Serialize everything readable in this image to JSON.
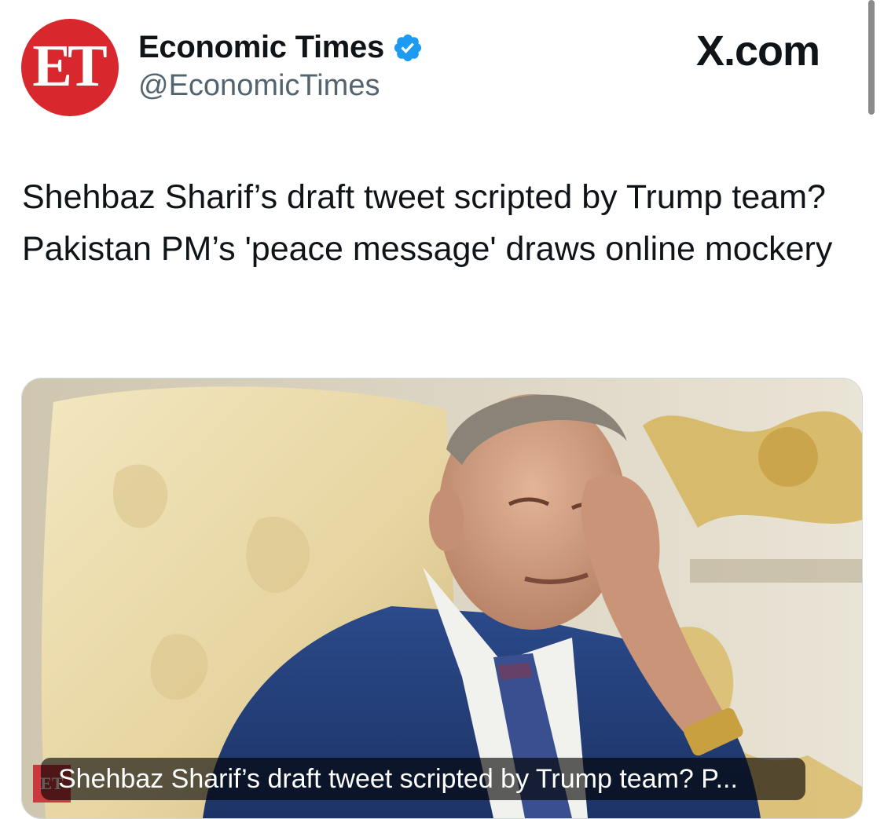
{
  "account": {
    "avatar_text": "ET",
    "name": "Economic Times",
    "handle": "@EconomicTimes",
    "verified_icon": "verified-badge-icon",
    "verified_color": "#1d9bf0",
    "avatar_color": "#d9272e"
  },
  "brand": {
    "label": "X.com"
  },
  "post": {
    "headline": "Shehbaz Sharif’s draft tweet scripted by Trump team? Pakistan PM’s 'peace message' draws online mockery"
  },
  "card": {
    "caption": "Shehbaz Sharif’s draft tweet scripted by Trump team? P...",
    "watermark": "ET"
  }
}
